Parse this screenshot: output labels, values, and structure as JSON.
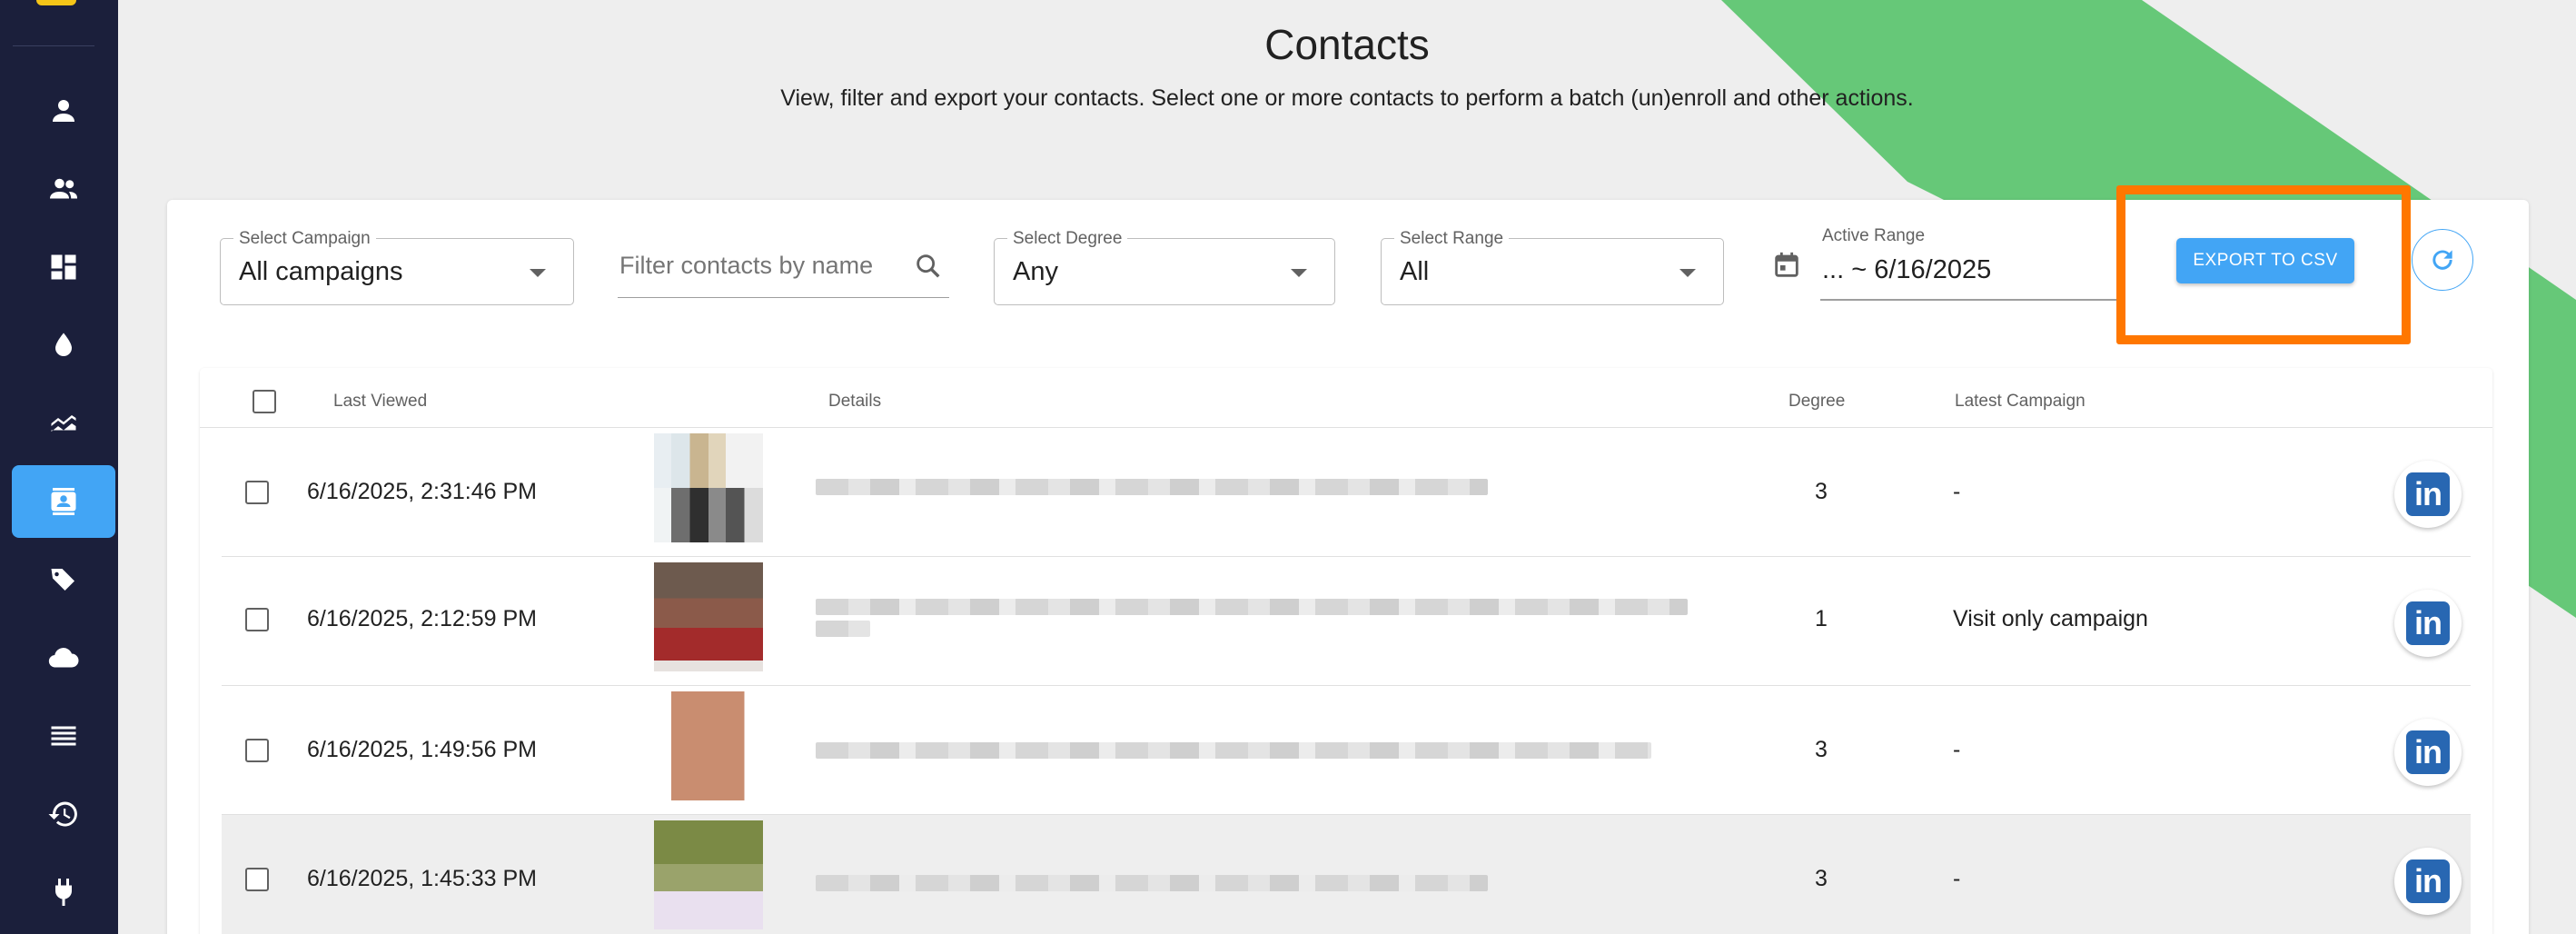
{
  "header": {
    "title": "Contacts",
    "subtitle": "View, filter and export your contacts. Select one or more contacts to perform a batch (un)enroll and other actions."
  },
  "sidebar": {
    "items": [
      {
        "icon": "person-icon"
      },
      {
        "icon": "people-icon"
      },
      {
        "icon": "dashboard-icon"
      },
      {
        "icon": "drop-icon"
      },
      {
        "icon": "chart-icon"
      },
      {
        "icon": "contacts-icon",
        "active": true
      },
      {
        "icon": "tags-icon"
      },
      {
        "icon": "cloud-icon"
      },
      {
        "icon": "list-icon"
      },
      {
        "icon": "history-icon"
      },
      {
        "icon": "plug-icon"
      }
    ]
  },
  "filters": {
    "campaign": {
      "label": "Select Campaign",
      "value": "All campaigns"
    },
    "search": {
      "placeholder": "Filter contacts by name",
      "value": ""
    },
    "degree": {
      "label": "Select Degree",
      "value": "Any"
    },
    "range": {
      "label": "Select Range",
      "value": "All"
    },
    "active_range": {
      "label": "Active Range",
      "value": "... ~ 6/16/2025"
    },
    "export_label": "EXPORT TO CSV"
  },
  "table": {
    "headers": {
      "last_viewed": "Last Viewed",
      "details": "Details",
      "degree": "Degree",
      "latest_campaign": "Latest Campaign"
    },
    "rows": [
      {
        "last_viewed": "6/16/2025, 2:31:46 PM",
        "degree": "3",
        "latest_campaign": "-"
      },
      {
        "last_viewed": "6/16/2025, 2:12:59 PM",
        "degree": "1",
        "latest_campaign": "Visit only campaign"
      },
      {
        "last_viewed": "6/16/2025, 1:49:56 PM",
        "degree": "3",
        "latest_campaign": "-"
      },
      {
        "last_viewed": "6/16/2025, 1:45:33 PM",
        "degree": "3",
        "latest_campaign": "-"
      }
    ],
    "linkedin_label": "in"
  },
  "colors": {
    "sidebar": "#1b1f3b",
    "accent": "#42a5f5",
    "highlight": "#ff7700",
    "deco_green": "#66c878",
    "linkedin": "#2867b2"
  }
}
